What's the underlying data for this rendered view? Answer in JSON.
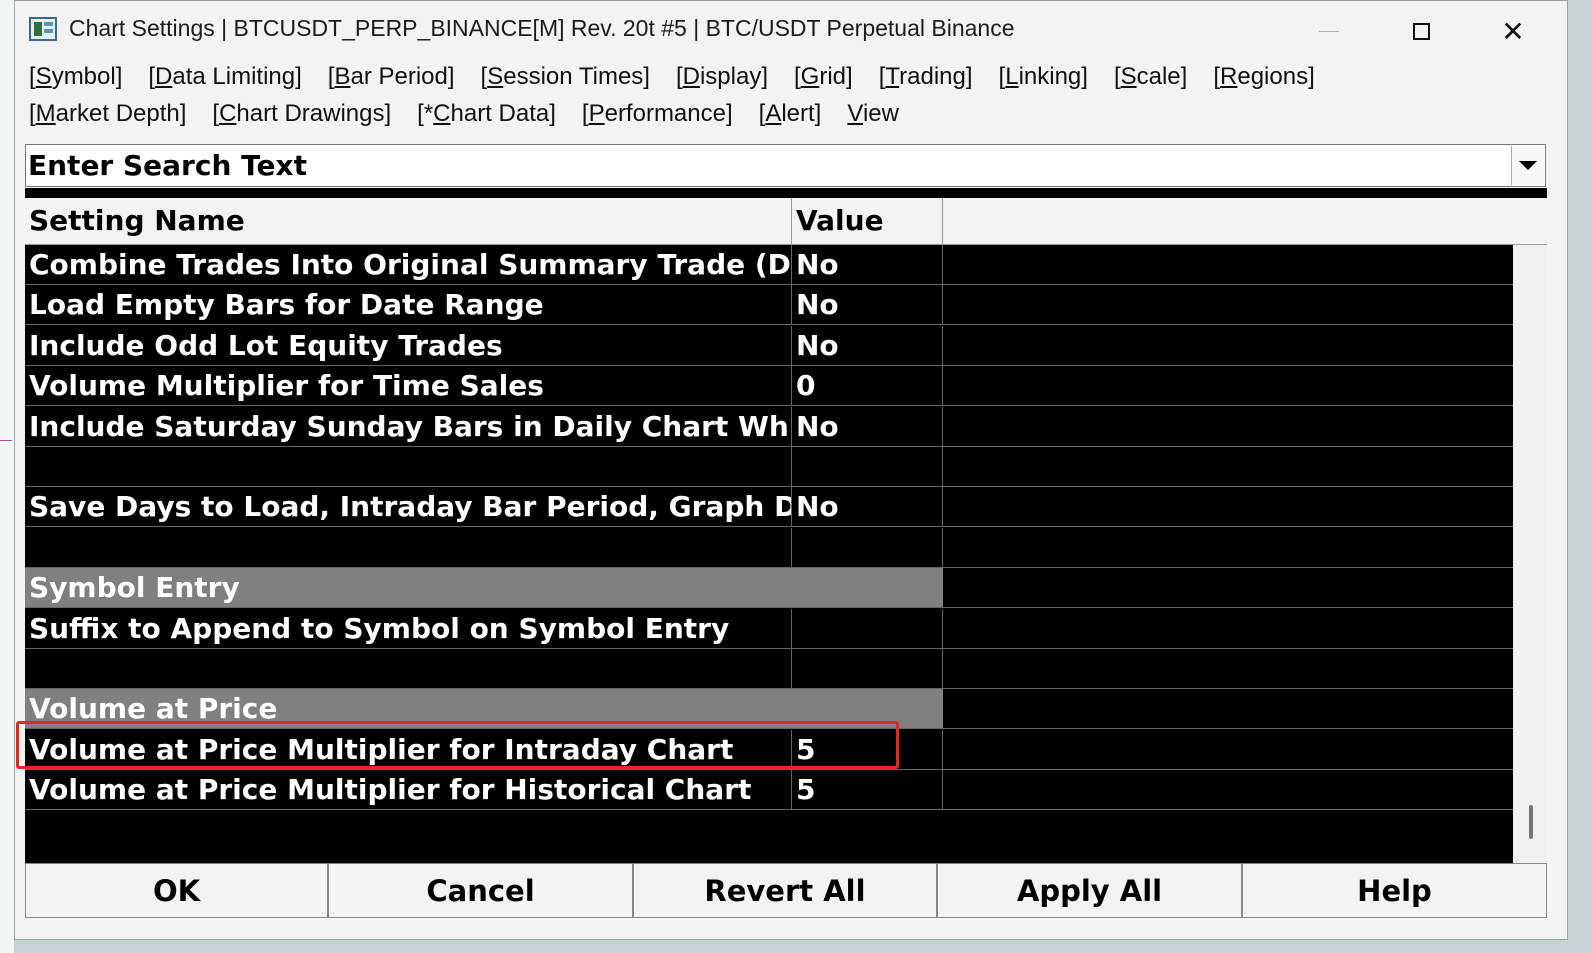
{
  "window": {
    "title": "Chart Settings | BTCUSDT_PERP_BINANCE[M]  Rev. 20t #5 | BTC/USDT Perpetual Binance"
  },
  "menu": {
    "row1": [
      {
        "pre": "[",
        "ul": "S",
        "post": "ymbol]"
      },
      {
        "pre": "[",
        "ul": "D",
        "post": "ata Limiting]"
      },
      {
        "pre": "[",
        "ul": "B",
        "post": "ar Period]"
      },
      {
        "pre": "[",
        "ul": "S",
        "post": "ession Times]"
      },
      {
        "pre": "[",
        "ul": "D",
        "post": "isplay]"
      },
      {
        "pre": "[",
        "ul": "G",
        "post": "rid]"
      },
      {
        "pre": "[",
        "ul": "T",
        "post": "rading]"
      },
      {
        "pre": "[",
        "ul": "L",
        "post": "inking]"
      },
      {
        "pre": "[",
        "ul": "S",
        "post": "cale]"
      },
      {
        "pre": "[",
        "ul": "R",
        "post": "egions]"
      }
    ],
    "row2": [
      {
        "pre": "[",
        "ul": "M",
        "post": "arket Depth]"
      },
      {
        "pre": "[",
        "ul": "C",
        "post": "hart Drawings]"
      },
      {
        "pre": "[*",
        "ul": "C",
        "post": "hart Data]"
      },
      {
        "pre": "[",
        "ul": "P",
        "post": "erformance]"
      },
      {
        "pre": "[",
        "ul": "A",
        "post": "lert]"
      },
      {
        "pre": "",
        "ul": "V",
        "post": "iew"
      }
    ]
  },
  "search": {
    "placeholder": "Enter Search Text"
  },
  "grid": {
    "header_name": "Setting Name",
    "header_value": "Value",
    "rows": [
      {
        "type": "setting",
        "name": "Combine Trades Into Original Summary Trade (D...",
        "value": "No"
      },
      {
        "type": "setting",
        "name": "Load Empty Bars for Date Range",
        "value": "No"
      },
      {
        "type": "setting",
        "name": "Include Odd Lot Equity Trades",
        "value": "No"
      },
      {
        "type": "setting",
        "name": "Volume Multiplier for Time Sales",
        "value": "0"
      },
      {
        "type": "setting",
        "name": "Include Saturday Sunday Bars in Daily Chart Wh...",
        "value": "No"
      },
      {
        "type": "blank",
        "name": "",
        "value": ""
      },
      {
        "type": "setting",
        "name": "Save Days to Load, Intraday Bar Period, Graph D...",
        "value": "No"
      },
      {
        "type": "blank",
        "name": "",
        "value": ""
      },
      {
        "type": "section",
        "name": "Symbol Entry",
        "value": ""
      },
      {
        "type": "setting",
        "name": "Suffix to Append to Symbol on Symbol Entry",
        "value": ""
      },
      {
        "type": "blank",
        "name": "",
        "value": ""
      },
      {
        "type": "section",
        "name": "Volume at Price",
        "value": ""
      },
      {
        "type": "setting",
        "name": "Volume at Price Multiplier for Intraday Chart",
        "value": "5"
      },
      {
        "type": "setting",
        "name": "Volume at Price Multiplier for Historical Chart",
        "value": "5"
      }
    ]
  },
  "buttons": {
    "ok": "OK",
    "cancel": "Cancel",
    "revert_all": "Revert All",
    "apply_all": "Apply All",
    "help": "Help"
  },
  "colors": {
    "highlight": "#e8261b",
    "section_bg": "#808080",
    "grid_bg": "#000000"
  }
}
